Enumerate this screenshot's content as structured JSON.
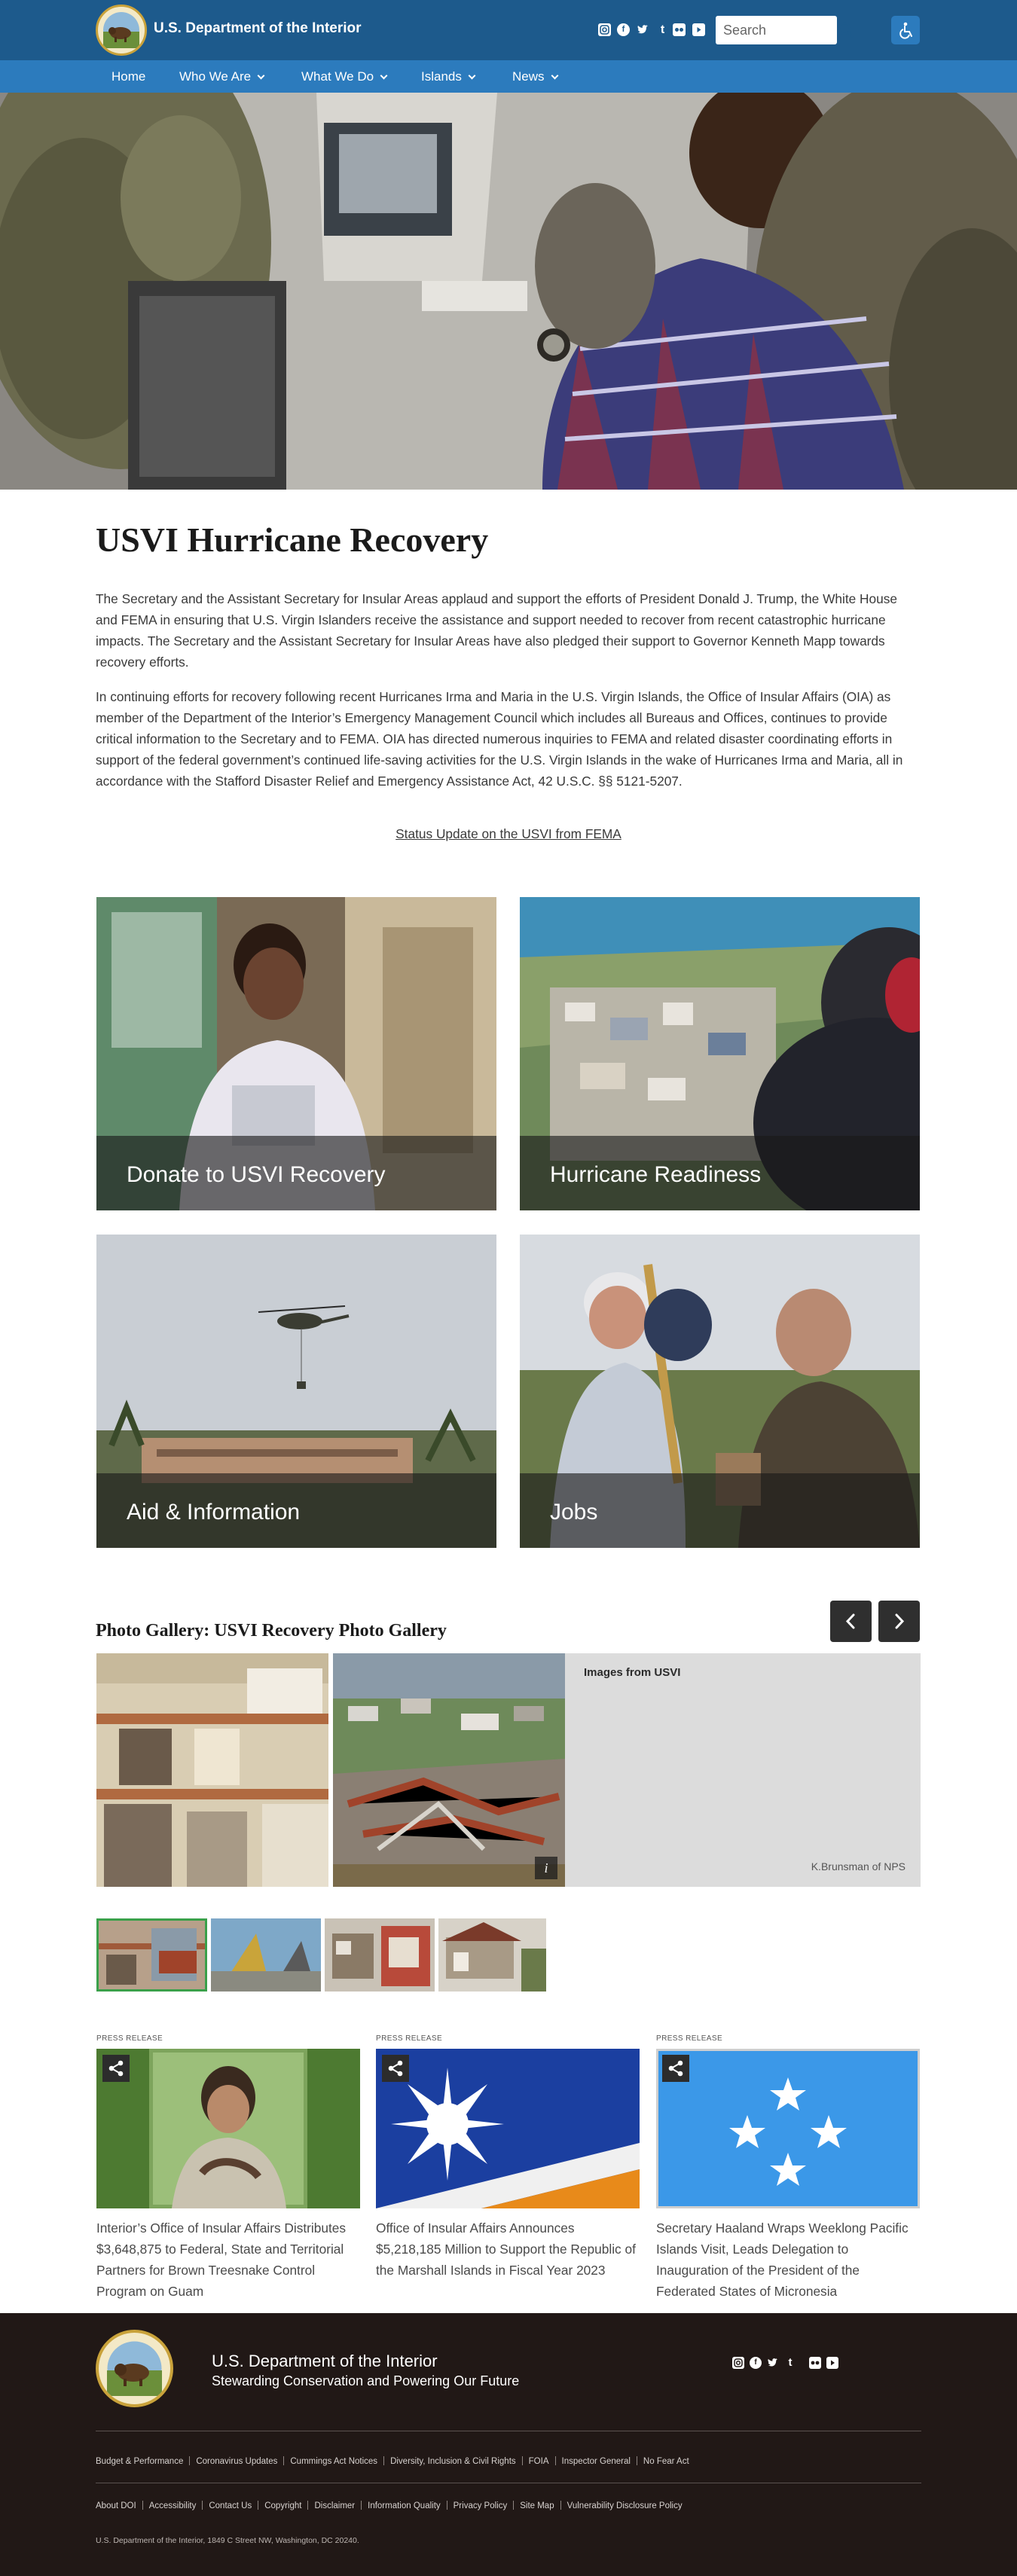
{
  "header": {
    "agency_name": "U.S. Department of the Interior",
    "social_icons": [
      "instagram-icon",
      "facebook-icon",
      "twitter-icon",
      "tumblr-icon",
      "flickr-icon",
      "youtube-icon"
    ],
    "search_placeholder": "Search",
    "brand_color": "#1d5a8c",
    "nav_color": "#2c7bbd"
  },
  "nav": {
    "items": [
      {
        "label": "Home",
        "has_dropdown": false
      },
      {
        "label": "Who We Are",
        "has_dropdown": true
      },
      {
        "label": "What We Do",
        "has_dropdown": true
      },
      {
        "label": "Islands",
        "has_dropdown": true
      },
      {
        "label": "News",
        "has_dropdown": true
      }
    ]
  },
  "page": {
    "title": "USVI Hurricane Recovery",
    "paragraph_1": "The Secretary and the Assistant Secretary for Insular Areas applaud and support the efforts of President Donald J. Trump, the White House and FEMA in ensuring that U.S. Virgin Islanders receive the assistance and support needed to recover from recent catastrophic hurricane impacts.  The Secretary and the Assistant Secretary for Insular Areas have also pledged their support to Governor Kenneth Mapp towards recovery efforts.",
    "paragraph_2": "In continuing efforts for recovery following recent Hurricanes Irma and Maria in the U.S. Virgin Islands, the Office of Insular Affairs (OIA) as member of the Department of the Interior’s Emergency Management Council which includes all Bureaus and Offices, continues to provide critical information to the Secretary and to FEMA.  OIA has directed numerous inquiries to FEMA and related disaster coordinating efforts in support of the federal government’s continued life-saving activities for the U.S. Virgin Islands in the wake of Hurricanes Irma and Maria, all in accordance with the Stafford Disaster Relief and Emergency Assistance Act, 42 U.S.C. §§ 5121-5207.",
    "fema_link": "Status Update on the USVI from FEMA"
  },
  "cards": [
    {
      "label": "Donate to USVI Recovery"
    },
    {
      "label": "Hurricane Readiness"
    },
    {
      "label": "Aid & Information"
    },
    {
      "label": "Jobs"
    }
  ],
  "gallery": {
    "title": "Photo Gallery: USVI Recovery Photo Gallery",
    "info_title": "Images from USVI",
    "credit": "K.Brunsman of NPS",
    "thumbnail_count": 4,
    "selected_thumbnail": 1
  },
  "press": [
    {
      "tag": "PRESS RELEASE",
      "title": "Interior’s Office of Insular Affairs Distributes $3,648,875 to Federal, State and Territorial Partners for Brown Treesnake Control Program on Guam"
    },
    {
      "tag": "PRESS RELEASE",
      "title": "Office of Insular Affairs Announces $5,218,185 Million to Support the Republic of the Marshall Islands in Fiscal Year 2023"
    },
    {
      "tag": "PRESS RELEASE",
      "title": "Secretary Haaland Wraps Weeklong Pacific Islands Visit, Leads Delegation to Inauguration of the President of the Federated States of Micronesia"
    }
  ],
  "footer": {
    "agency_name": "U.S. Department of the Interior",
    "tagline": "Stewarding Conservation and Powering Our Future",
    "links_row_1": [
      "Budget & Performance",
      "Coronavirus Updates",
      "Cummings Act Notices",
      "Diversity, Inclusion & Civil Rights",
      "FOIA",
      "Inspector General",
      "No Fear Act"
    ],
    "links_row_2": [
      "About DOI",
      "Accessibility",
      "Contact Us",
      "Copyright",
      "Disclaimer",
      "Information Quality",
      "Privacy Policy",
      "Site Map",
      "Vulnerability Disclosure Policy"
    ],
    "address": "U.S. Department of the Interior, 1849 C Street NW, Washington, DC 20240."
  }
}
